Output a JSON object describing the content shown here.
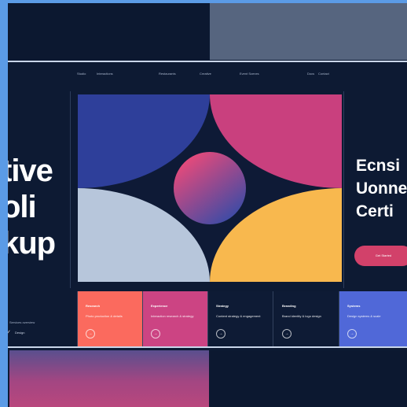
{
  "nav": {
    "items": [
      "Studio",
      "Interactions",
      "Restaurants",
      "Creative",
      "Event Scenes",
      "Docs",
      "Contact"
    ]
  },
  "hero": {
    "left_lines": [
      "tive",
      "oli",
      "kup"
    ],
    "right_lines": [
      "Ecnsi",
      "Uonne",
      "Certi"
    ],
    "cta_label": "Get Started"
  },
  "cards": {
    "aside_label": "Services overview",
    "aside_mark": "Design",
    "items": [
      {
        "title": "Research",
        "subtitle": "Photo production & details",
        "arrow": "→"
      },
      {
        "title": "Experience",
        "subtitle": "Interaction research & strategy",
        "arrow": "→"
      },
      {
        "title": "Strategy",
        "subtitle": "Content strategy & engagement",
        "arrow": "→"
      },
      {
        "title": "Branding",
        "subtitle": "Brand identity & logo design",
        "arrow": "→"
      },
      {
        "title": "Systems",
        "subtitle": "Design systems & scale",
        "arrow": "→"
      }
    ]
  },
  "colors": {
    "background": "#5b9be6",
    "canvas": "#0d1a33",
    "navy": "#2e3f9a",
    "magenta": "#c9407e",
    "pale_blue": "#b7c6db",
    "yellow": "#f8b84e",
    "coral": "#fb6a5e",
    "pink": "#cc4483",
    "indigo": "#5068d8"
  }
}
